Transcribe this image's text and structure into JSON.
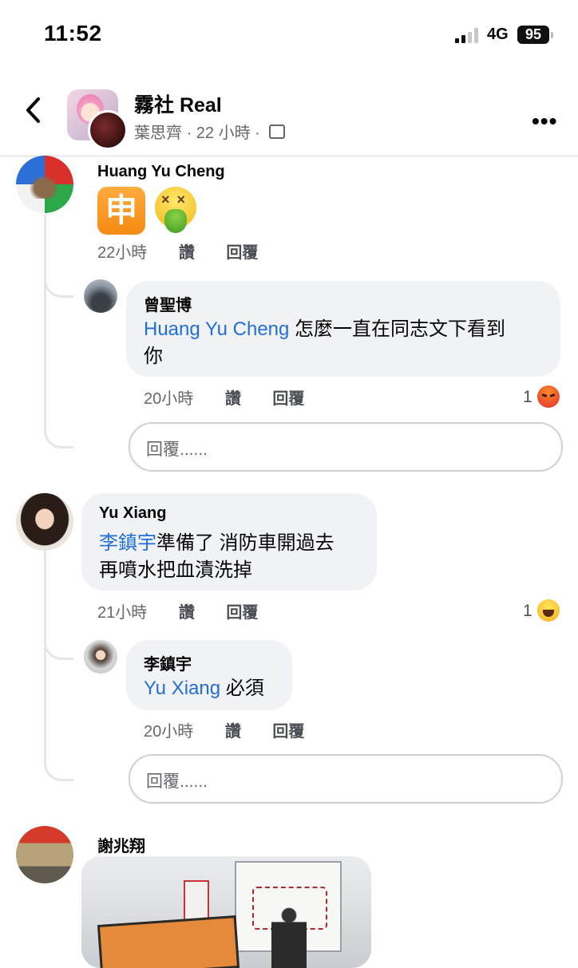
{
  "status_bar": {
    "time": "11:52",
    "network": "4G",
    "battery": "95"
  },
  "header": {
    "title": "霧社 Real",
    "author": "葉思齊",
    "time_ago": "22 小時",
    "separator": "·"
  },
  "comments": [
    {
      "name": "Huang Yu Cheng",
      "emoji_char": "申",
      "time": "22小時",
      "like": "讚",
      "reply": "回覆",
      "replies": [
        {
          "name": "曾聖博",
          "mention": "Huang Yu Cheng",
          "text_line1": " 怎麼一直在同志文下看到",
          "text_line2": "你",
          "time": "20小時",
          "like": "讚",
          "reply": "回覆",
          "reaction_count": "1",
          "reaction_icon": "angry-icon"
        }
      ],
      "reply_placeholder": "回覆......"
    },
    {
      "name": "Yu Xiang",
      "mention": "李鎮宇",
      "text_line1": "準備了 消防車開過去",
      "text_line2": "再噴水把血漬洗掉",
      "time": "21小時",
      "like": "讚",
      "reply": "回覆",
      "reaction_count": "1",
      "reaction_icon": "haha-icon",
      "replies": [
        {
          "name": "李鎮宇",
          "mention": "Yu Xiang",
          "text_line1": " 必須",
          "time": "20小時",
          "like": "讚",
          "reply": "回覆"
        }
      ],
      "reply_placeholder": "回覆......"
    },
    {
      "name": "謝兆翔"
    }
  ],
  "colors": {
    "mention": "#216fdb",
    "bubble": "#f0f2f5",
    "meta": "#65676b"
  }
}
